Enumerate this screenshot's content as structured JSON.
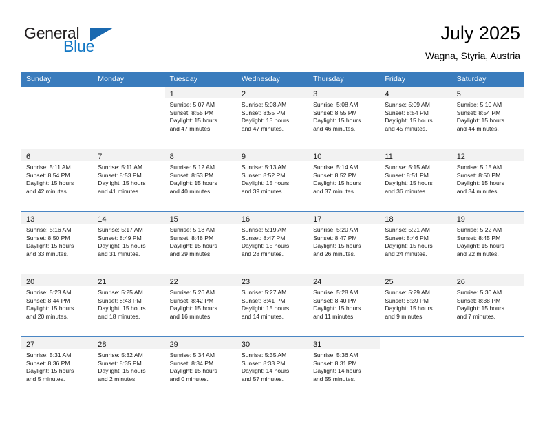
{
  "brand": {
    "line1": "General",
    "line2": "Blue",
    "flag_icon": "triangle-flag-icon"
  },
  "header": {
    "title": "July 2025",
    "subtitle": "Wagna, Styria, Austria"
  },
  "colors": {
    "header_blue": "#3a7cbd",
    "row_divider": "#4a86c4",
    "daynum_band": "#f2f2f2",
    "brand_blue": "#1277c4",
    "flag_blue": "#1a69b0",
    "text": "#1a1a1a"
  },
  "weekdays": [
    "Sunday",
    "Monday",
    "Tuesday",
    "Wednesday",
    "Thursday",
    "Friday",
    "Saturday"
  ],
  "weeks": [
    [
      {
        "day": "",
        "blank": true,
        "sunrise": "",
        "sunset": "",
        "daylight1": "",
        "daylight2": ""
      },
      {
        "day": "",
        "blank": true,
        "sunrise": "",
        "sunset": "",
        "daylight1": "",
        "daylight2": ""
      },
      {
        "day": "1",
        "sunrise": "Sunrise: 5:07 AM",
        "sunset": "Sunset: 8:55 PM",
        "daylight1": "Daylight: 15 hours",
        "daylight2": "and 47 minutes."
      },
      {
        "day": "2",
        "sunrise": "Sunrise: 5:08 AM",
        "sunset": "Sunset: 8:55 PM",
        "daylight1": "Daylight: 15 hours",
        "daylight2": "and 47 minutes."
      },
      {
        "day": "3",
        "sunrise": "Sunrise: 5:08 AM",
        "sunset": "Sunset: 8:55 PM",
        "daylight1": "Daylight: 15 hours",
        "daylight2": "and 46 minutes."
      },
      {
        "day": "4",
        "sunrise": "Sunrise: 5:09 AM",
        "sunset": "Sunset: 8:54 PM",
        "daylight1": "Daylight: 15 hours",
        "daylight2": "and 45 minutes."
      },
      {
        "day": "5",
        "sunrise": "Sunrise: 5:10 AM",
        "sunset": "Sunset: 8:54 PM",
        "daylight1": "Daylight: 15 hours",
        "daylight2": "and 44 minutes."
      }
    ],
    [
      {
        "day": "6",
        "sunrise": "Sunrise: 5:11 AM",
        "sunset": "Sunset: 8:54 PM",
        "daylight1": "Daylight: 15 hours",
        "daylight2": "and 42 minutes."
      },
      {
        "day": "7",
        "sunrise": "Sunrise: 5:11 AM",
        "sunset": "Sunset: 8:53 PM",
        "daylight1": "Daylight: 15 hours",
        "daylight2": "and 41 minutes."
      },
      {
        "day": "8",
        "sunrise": "Sunrise: 5:12 AM",
        "sunset": "Sunset: 8:53 PM",
        "daylight1": "Daylight: 15 hours",
        "daylight2": "and 40 minutes."
      },
      {
        "day": "9",
        "sunrise": "Sunrise: 5:13 AM",
        "sunset": "Sunset: 8:52 PM",
        "daylight1": "Daylight: 15 hours",
        "daylight2": "and 39 minutes."
      },
      {
        "day": "10",
        "sunrise": "Sunrise: 5:14 AM",
        "sunset": "Sunset: 8:52 PM",
        "daylight1": "Daylight: 15 hours",
        "daylight2": "and 37 minutes."
      },
      {
        "day": "11",
        "sunrise": "Sunrise: 5:15 AM",
        "sunset": "Sunset: 8:51 PM",
        "daylight1": "Daylight: 15 hours",
        "daylight2": "and 36 minutes."
      },
      {
        "day": "12",
        "sunrise": "Sunrise: 5:15 AM",
        "sunset": "Sunset: 8:50 PM",
        "daylight1": "Daylight: 15 hours",
        "daylight2": "and 34 minutes."
      }
    ],
    [
      {
        "day": "13",
        "sunrise": "Sunrise: 5:16 AM",
        "sunset": "Sunset: 8:50 PM",
        "daylight1": "Daylight: 15 hours",
        "daylight2": "and 33 minutes."
      },
      {
        "day": "14",
        "sunrise": "Sunrise: 5:17 AM",
        "sunset": "Sunset: 8:49 PM",
        "daylight1": "Daylight: 15 hours",
        "daylight2": "and 31 minutes."
      },
      {
        "day": "15",
        "sunrise": "Sunrise: 5:18 AM",
        "sunset": "Sunset: 8:48 PM",
        "daylight1": "Daylight: 15 hours",
        "daylight2": "and 29 minutes."
      },
      {
        "day": "16",
        "sunrise": "Sunrise: 5:19 AM",
        "sunset": "Sunset: 8:47 PM",
        "daylight1": "Daylight: 15 hours",
        "daylight2": "and 28 minutes."
      },
      {
        "day": "17",
        "sunrise": "Sunrise: 5:20 AM",
        "sunset": "Sunset: 8:47 PM",
        "daylight1": "Daylight: 15 hours",
        "daylight2": "and 26 minutes."
      },
      {
        "day": "18",
        "sunrise": "Sunrise: 5:21 AM",
        "sunset": "Sunset: 8:46 PM",
        "daylight1": "Daylight: 15 hours",
        "daylight2": "and 24 minutes."
      },
      {
        "day": "19",
        "sunrise": "Sunrise: 5:22 AM",
        "sunset": "Sunset: 8:45 PM",
        "daylight1": "Daylight: 15 hours",
        "daylight2": "and 22 minutes."
      }
    ],
    [
      {
        "day": "20",
        "sunrise": "Sunrise: 5:23 AM",
        "sunset": "Sunset: 8:44 PM",
        "daylight1": "Daylight: 15 hours",
        "daylight2": "and 20 minutes."
      },
      {
        "day": "21",
        "sunrise": "Sunrise: 5:25 AM",
        "sunset": "Sunset: 8:43 PM",
        "daylight1": "Daylight: 15 hours",
        "daylight2": "and 18 minutes."
      },
      {
        "day": "22",
        "sunrise": "Sunrise: 5:26 AM",
        "sunset": "Sunset: 8:42 PM",
        "daylight1": "Daylight: 15 hours",
        "daylight2": "and 16 minutes."
      },
      {
        "day": "23",
        "sunrise": "Sunrise: 5:27 AM",
        "sunset": "Sunset: 8:41 PM",
        "daylight1": "Daylight: 15 hours",
        "daylight2": "and 14 minutes."
      },
      {
        "day": "24",
        "sunrise": "Sunrise: 5:28 AM",
        "sunset": "Sunset: 8:40 PM",
        "daylight1": "Daylight: 15 hours",
        "daylight2": "and 11 minutes."
      },
      {
        "day": "25",
        "sunrise": "Sunrise: 5:29 AM",
        "sunset": "Sunset: 8:39 PM",
        "daylight1": "Daylight: 15 hours",
        "daylight2": "and 9 minutes."
      },
      {
        "day": "26",
        "sunrise": "Sunrise: 5:30 AM",
        "sunset": "Sunset: 8:38 PM",
        "daylight1": "Daylight: 15 hours",
        "daylight2": "and 7 minutes."
      }
    ],
    [
      {
        "day": "27",
        "sunrise": "Sunrise: 5:31 AM",
        "sunset": "Sunset: 8:36 PM",
        "daylight1": "Daylight: 15 hours",
        "daylight2": "and 5 minutes."
      },
      {
        "day": "28",
        "sunrise": "Sunrise: 5:32 AM",
        "sunset": "Sunset: 8:35 PM",
        "daylight1": "Daylight: 15 hours",
        "daylight2": "and 2 minutes."
      },
      {
        "day": "29",
        "sunrise": "Sunrise: 5:34 AM",
        "sunset": "Sunset: 8:34 PM",
        "daylight1": "Daylight: 15 hours",
        "daylight2": "and 0 minutes."
      },
      {
        "day": "30",
        "sunrise": "Sunrise: 5:35 AM",
        "sunset": "Sunset: 8:33 PM",
        "daylight1": "Daylight: 14 hours",
        "daylight2": "and 57 minutes."
      },
      {
        "day": "31",
        "sunrise": "Sunrise: 5:36 AM",
        "sunset": "Sunset: 8:31 PM",
        "daylight1": "Daylight: 14 hours",
        "daylight2": "and 55 minutes."
      },
      {
        "day": "",
        "blank": true,
        "sunrise": "",
        "sunset": "",
        "daylight1": "",
        "daylight2": ""
      },
      {
        "day": "",
        "blank": true,
        "sunrise": "",
        "sunset": "",
        "daylight1": "",
        "daylight2": ""
      }
    ]
  ]
}
